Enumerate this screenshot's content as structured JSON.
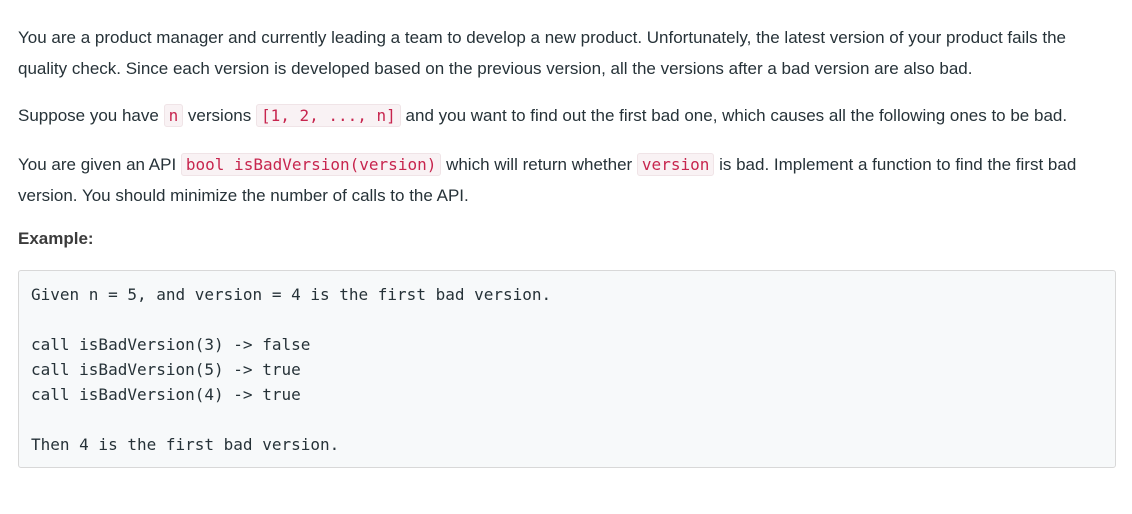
{
  "problem": {
    "paragraph1": "You are a product manager and currently leading a team to develop a new product. Unfortunately, the latest version of your product fails the quality check. Since each version is developed based on the previous version, all the versions after a bad version are also bad.",
    "paragraph2": {
      "part1": "Suppose you have ",
      "code1": "n",
      "part2": " versions ",
      "code2": "[1, 2, ..., n]",
      "part3": " and you want to find out the first bad one, which causes all the following ones to be bad."
    },
    "paragraph3": {
      "part1": "You are given an API ",
      "code1": "bool isBadVersion(version)",
      "part2": " which will return whether ",
      "code2": "version",
      "part3": " is bad. Implement a function to find the first bad version. You should minimize the number of calls to the API."
    },
    "example_heading": "Example:",
    "example_lines": [
      "Given n = 5, and version = 4 is the first bad version.",
      "",
      "call isBadVersion(3) -> false",
      "call isBadVersion(5) -> true",
      "call isBadVersion(4) -> true",
      "",
      "Then 4 is the first bad version."
    ]
  }
}
